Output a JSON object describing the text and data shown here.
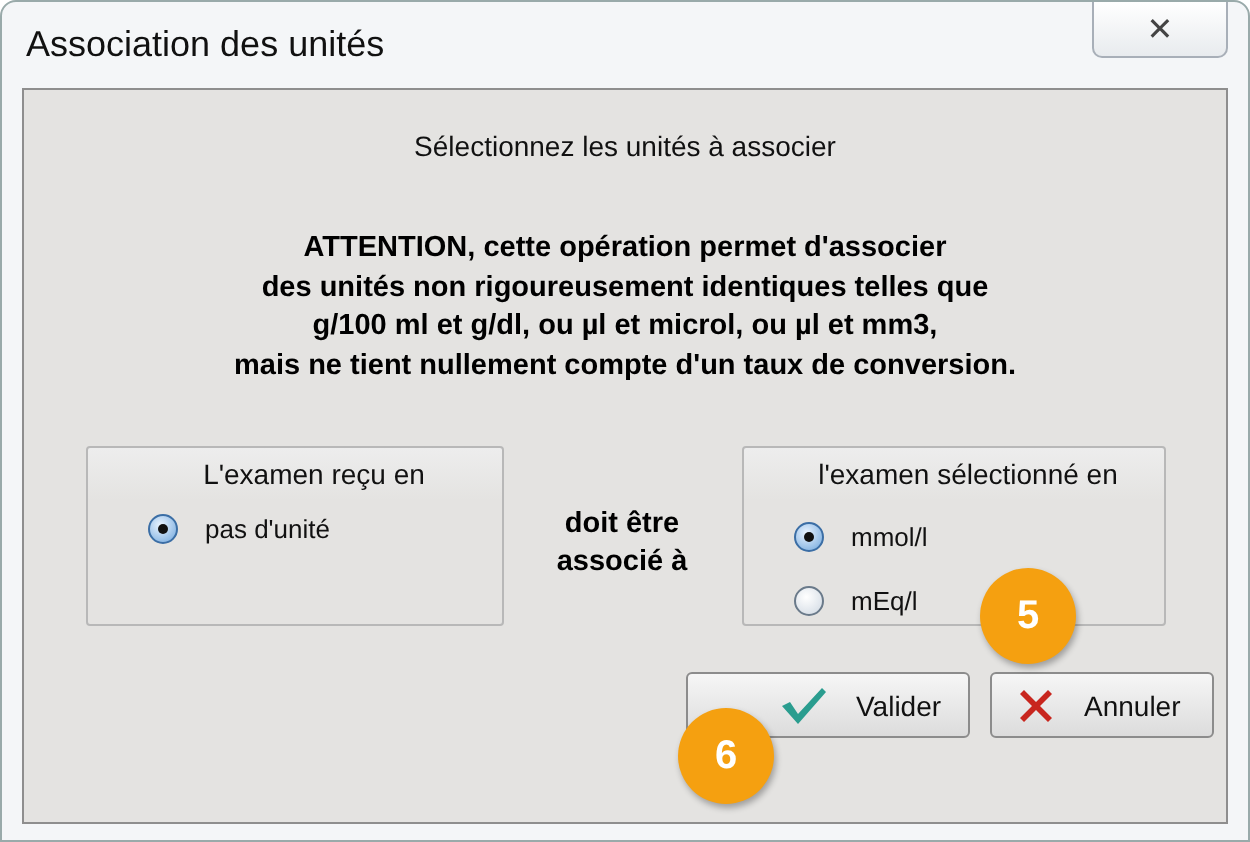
{
  "window": {
    "title": "Association des unités",
    "close": "✕"
  },
  "heading": "Sélectionnez les unités à associer",
  "warning": [
    "ATTENTION, cette opération permet d'associer",
    "des unités non rigoureusement identiques telles que",
    "g/100 ml et g/dl, ou µl et microl, ou µl et mm3,",
    "mais ne tient nullement compte d'un taux de conversion."
  ],
  "received_group": {
    "title": "L'examen reçu en",
    "options": [
      {
        "label": "pas d'unité",
        "selected": true
      }
    ]
  },
  "middle_text": [
    "doit être",
    "associé à"
  ],
  "selected_group": {
    "title": "l'examen sélectionné en",
    "options": [
      {
        "label": "mmol/l",
        "selected": true
      },
      {
        "label": "mEq/l",
        "selected": false
      }
    ]
  },
  "buttons": [
    {
      "kind": "ok",
      "label": "Valider"
    },
    {
      "kind": "cancel",
      "label": "Annuler"
    }
  ],
  "callouts": [
    {
      "label": "5"
    },
    {
      "label": "6"
    }
  ]
}
